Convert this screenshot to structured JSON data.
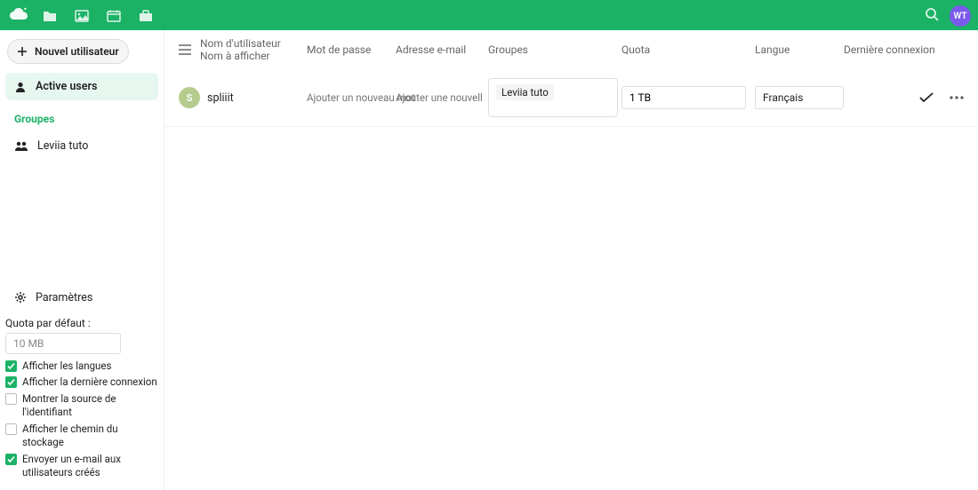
{
  "topbar": {
    "avatar_initials": "WT"
  },
  "sidebar": {
    "new_user_label": "Nouvel utilisateur",
    "active_users_label": "Active users",
    "groups_title": "Groupes",
    "group_items": [
      {
        "label": "Leviia tuto"
      }
    ],
    "settings_label": "Paramètres",
    "default_quota_label": "Quota par défaut :",
    "default_quota_value": "10 MB",
    "options": [
      {
        "label": "Afficher les langues",
        "checked": true
      },
      {
        "label": "Afficher la dernière connexion",
        "checked": true
      },
      {
        "label": "Montrer la source de l'identifiant",
        "checked": false
      },
      {
        "label": "Afficher le chemin du stockage",
        "checked": false
      },
      {
        "label": "Envoyer un e-mail aux utilisateurs créés",
        "checked": true
      }
    ]
  },
  "table": {
    "headers": {
      "username_line1": "Nom d'utilisateur",
      "username_line2": "Nom à afficher",
      "password": "Mot de passe",
      "email": "Adresse e-mail",
      "groups": "Groupes",
      "quota": "Quota",
      "language": "Langue",
      "last_login": "Dernière connexion"
    },
    "rows": [
      {
        "avatar_initial": "S",
        "username": "spliiit",
        "password_placeholder": "Ajouter un nouveau mot",
        "email_placeholder": "Ajouter une nouvelle …",
        "group_tag": "Leviia tuto",
        "quota": "1 TB",
        "language": "Français"
      }
    ]
  }
}
